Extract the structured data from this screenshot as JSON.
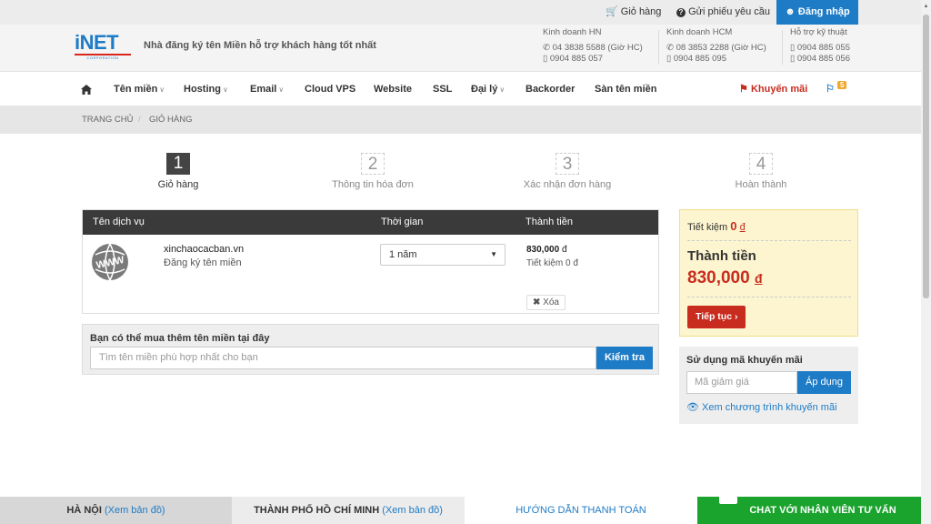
{
  "topbar": {
    "cart": "Giỏ hàng",
    "ticket": "Gửi phiếu yêu cầu",
    "login": "Đăng nhập"
  },
  "header": {
    "logo_text": "iNET",
    "logo_sub": "CORPORATION",
    "slogan": "Nhà đăng ký tên Miền hỗ trợ khách hàng tốt nhất",
    "contacts": [
      {
        "title": "Kinh doanh HN",
        "phone": "04 3838 5588 (Giờ HC)",
        "mobile": "0904 885 057"
      },
      {
        "title": "Kinh doanh HCM",
        "phone": "08 3853 2288 (Giờ HC)",
        "mobile": "0904 885 095"
      },
      {
        "title": "Hỗ trợ kỹ thuật",
        "phone": "0904 885 055",
        "mobile": "0904 885 056"
      }
    ]
  },
  "nav": {
    "items": [
      "Tên miền",
      "Hosting",
      "Email",
      "Cloud VPS",
      "Website",
      "SSL",
      "Đại lý",
      "Backorder",
      "Sàn tên miền"
    ],
    "promo": "Khuyến mãi",
    "flag_count": "5"
  },
  "breadcrumb": {
    "home": "TRANG CHỦ",
    "sep": "/",
    "current": "GIỎ HÀNG"
  },
  "steps": [
    {
      "num": "1",
      "label": "Giỏ hàng"
    },
    {
      "num": "2",
      "label": "Thông tin hóa đơn"
    },
    {
      "num": "3",
      "label": "Xác nhận đơn hàng"
    },
    {
      "num": "4",
      "label": "Hoàn thành"
    }
  ],
  "cart": {
    "headers": [
      "Tên dịch vụ",
      "Thời gian",
      "Thành tiền"
    ],
    "item": {
      "domain": "xinchaocacban.vn",
      "type": "Đăng ký tên miền",
      "icon_text": "WWW",
      "period": "1 năm",
      "price": "830,000",
      "currency": "đ",
      "saving": "Tiết kiệm 0",
      "delete": "Xóa"
    }
  },
  "search": {
    "title": "Bạn có thể mua thêm tên miền tại đây",
    "placeholder": "Tìm tên miền phù hợp nhất cho bạn",
    "button": "Kiểm tra"
  },
  "summary": {
    "saving_label": "Tiết kiệm",
    "saving_value": "0",
    "currency": "đ",
    "total_label": "Thành tiền",
    "total_value": "830,000",
    "continue": "Tiếp tục"
  },
  "promo": {
    "title": "Sử dụng mã khuyến mãi",
    "placeholder": "Mã giảm giá",
    "apply": "Áp dụng",
    "link": "Xem chương trình khuyến mãi"
  },
  "footer": {
    "hn_label": "HÀ NỘI",
    "hn_link": "(Xem bản đồ)",
    "hcm_label": "THÀNH PHỐ HỒ CHÍ MINH",
    "hcm_link": "(Xem bản đồ)",
    "guide": "HƯỚNG DẪN THANH TOÁN",
    "chat": "CHAT VỚI NHÂN VIÊN TƯ VẤN"
  },
  "colors": {
    "brand_blue": "#1e7bc5",
    "accent_red": "#c82c1f",
    "chat_green": "#1aa32d"
  }
}
